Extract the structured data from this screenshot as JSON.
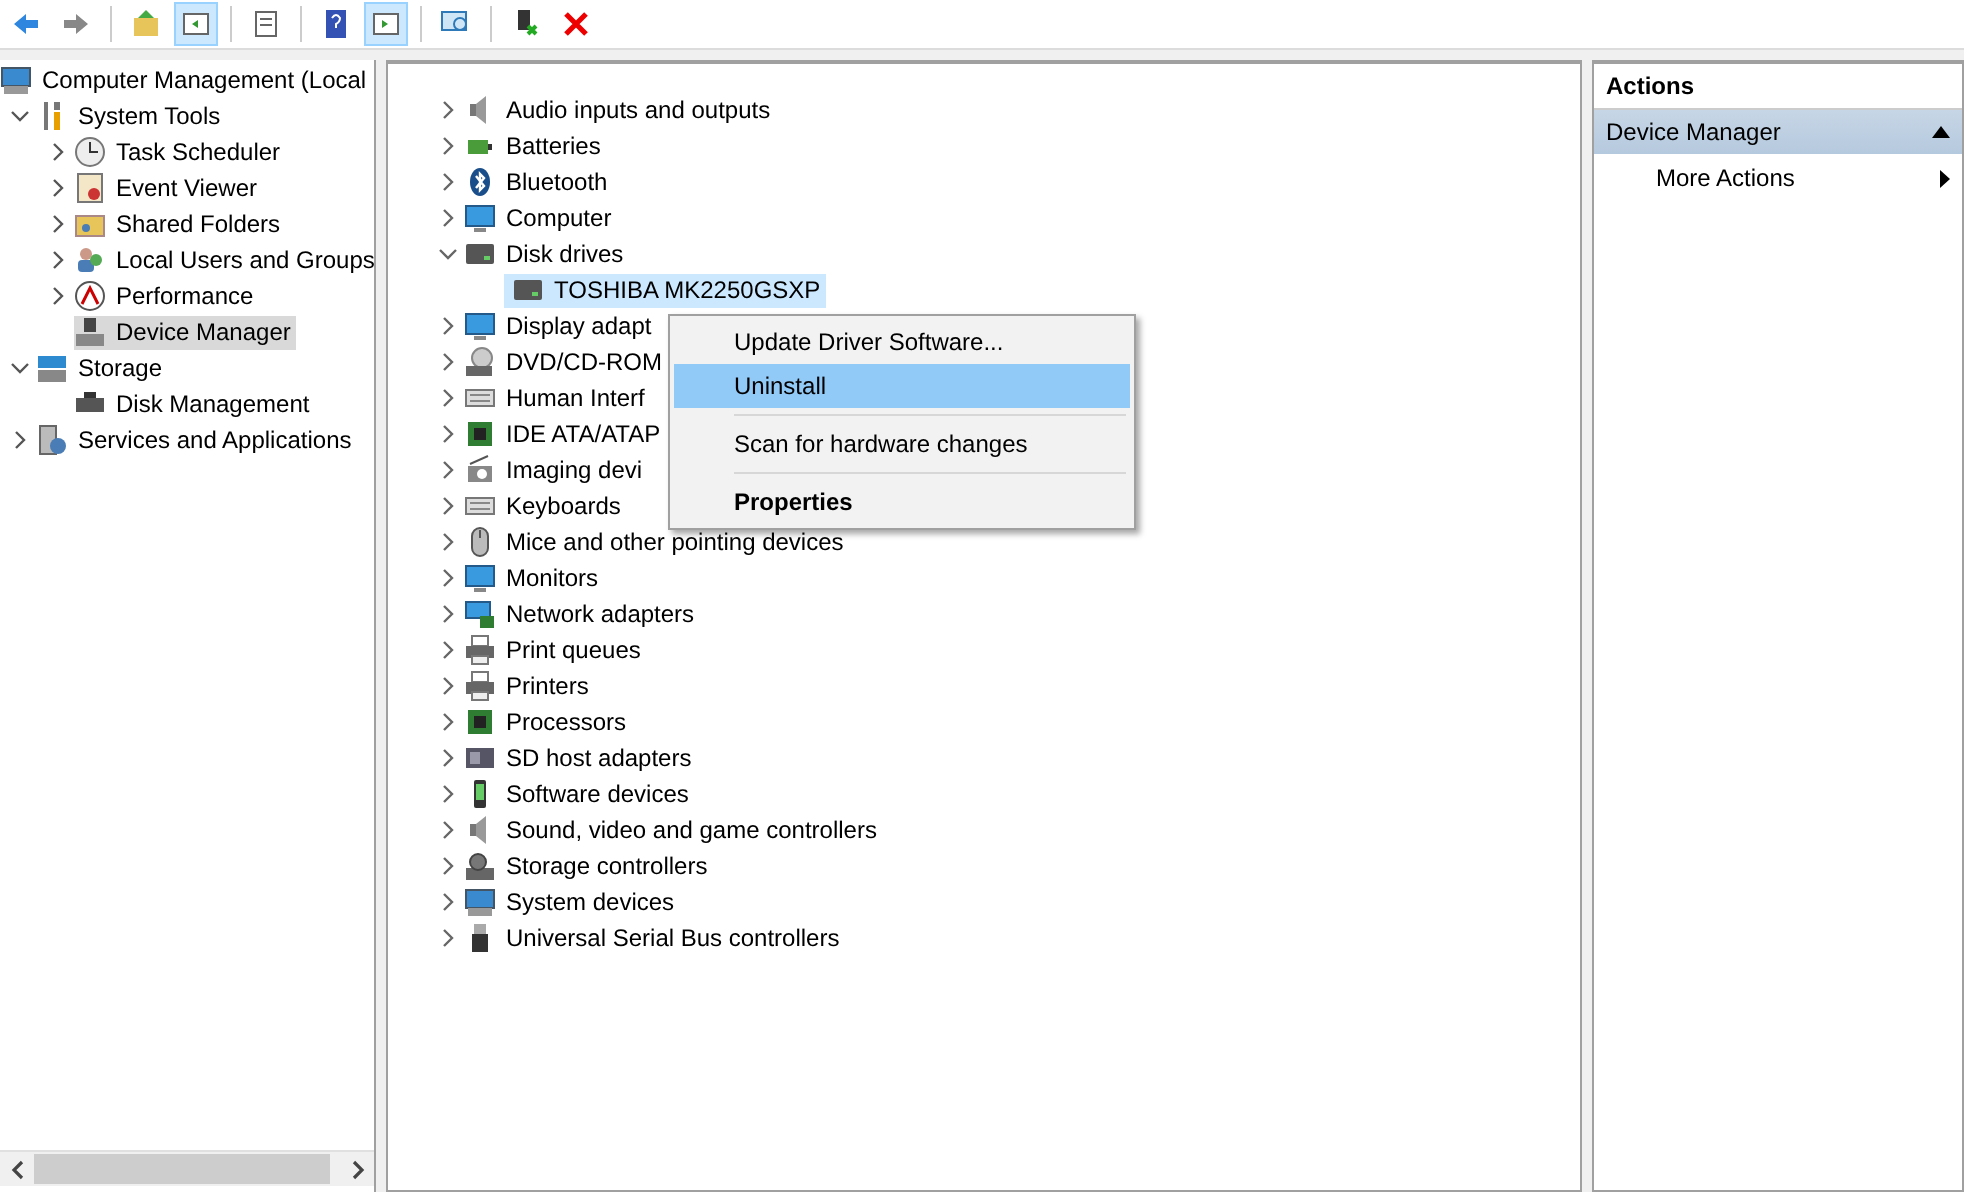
{
  "toolbar": [
    {
      "on": false
    },
    {
      "on": false
    },
    {
      "on": false
    },
    {
      "on": true
    },
    {
      "on": false
    },
    {
      "on": false
    },
    {
      "on": true
    },
    {
      "on": false
    },
    {
      "on": false
    },
    {
      "on": false
    }
  ],
  "console_tree": {
    "items": [
      {
        "label": "Computer Management (Local",
        "selected": false,
        "children": [
          {
            "label": "System Tools",
            "selected": false,
            "expanded": true,
            "children": [
              {
                "label": "Task Scheduler",
                "selected": false,
                "expanded": false
              },
              {
                "label": "Event Viewer",
                "selected": false,
                "expanded": false
              },
              {
                "label": "Shared Folders",
                "selected": false,
                "expanded": false
              },
              {
                "label": "Local Users and Groups",
                "selected": false,
                "expanded": false
              },
              {
                "label": "Performance",
                "selected": false,
                "expanded": false
              },
              {
                "label": "Device Manager",
                "selected": true
              }
            ]
          },
          {
            "label": "Storage",
            "selected": false,
            "expanded": true,
            "children": [
              {
                "label": "Disk Management",
                "selected": false
              }
            ]
          },
          {
            "label": "Services and Applications",
            "selected": false,
            "expanded": false
          }
        ]
      }
    ]
  },
  "devices": [
    {
      "label": "Audio inputs and outputs",
      "expanded": false
    },
    {
      "label": "Batteries",
      "expanded": false
    },
    {
      "label": "Bluetooth",
      "expanded": false
    },
    {
      "label": "Computer",
      "expanded": false
    },
    {
      "label": "Disk drives",
      "expanded": true,
      "children": [
        {
          "label": "TOSHIBA MK2250GSXP",
          "selected": true
        }
      ]
    },
    {
      "label": "Display adapt",
      "expanded": false
    },
    {
      "label": "DVD/CD-ROM",
      "expanded": false
    },
    {
      "label": "Human Interf",
      "expanded": false
    },
    {
      "label": "IDE ATA/ATAP",
      "expanded": false
    },
    {
      "label": "Imaging devi",
      "expanded": false
    },
    {
      "label": "Keyboards",
      "expanded": false
    },
    {
      "label": "Mice and other pointing devices",
      "expanded": false
    },
    {
      "label": "Monitors",
      "expanded": false
    },
    {
      "label": "Network adapters",
      "expanded": false
    },
    {
      "label": "Print queues",
      "expanded": false
    },
    {
      "label": "Printers",
      "expanded": false
    },
    {
      "label": "Processors",
      "expanded": false
    },
    {
      "label": "SD host adapters",
      "expanded": false
    },
    {
      "label": "Software devices",
      "expanded": false
    },
    {
      "label": "Sound, video and game controllers",
      "expanded": false
    },
    {
      "label": "Storage controllers",
      "expanded": false
    },
    {
      "label": "System devices",
      "expanded": false
    },
    {
      "label": "Universal Serial Bus controllers",
      "expanded": false
    }
  ],
  "context_menu": {
    "items": [
      {
        "kind": "item",
        "label": "Update Driver Software...",
        "selected": false,
        "bold": false
      },
      {
        "kind": "item",
        "label": "Uninstall",
        "selected": true,
        "bold": false
      },
      {
        "kind": "separator"
      },
      {
        "kind": "item",
        "label": "Scan for hardware changes",
        "selected": false,
        "bold": false
      },
      {
        "kind": "separator"
      },
      {
        "kind": "item",
        "label": "Properties",
        "selected": false,
        "bold": true
      }
    ]
  },
  "actions": {
    "title": "Actions",
    "section": {
      "label": "Device Manager",
      "expanded": true
    },
    "items": [
      {
        "label": "More Actions"
      }
    ]
  }
}
